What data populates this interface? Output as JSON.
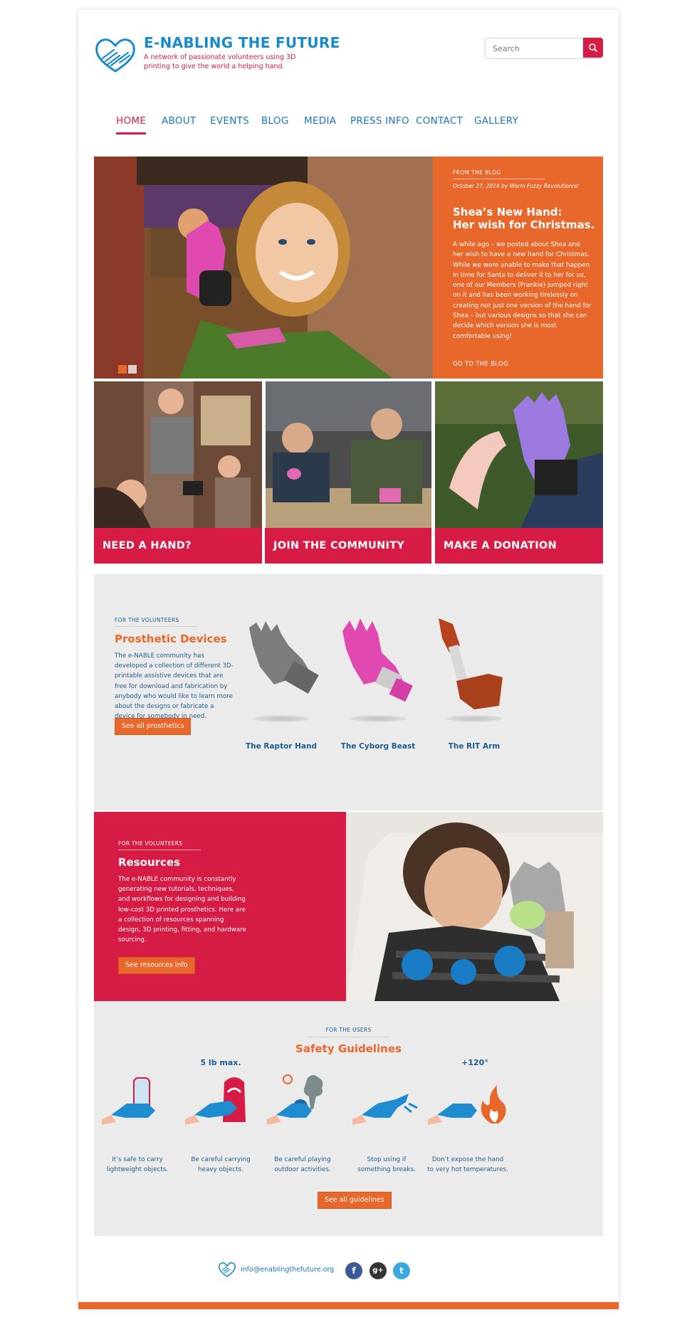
{
  "header": {
    "brand_title": "E-NABLING THE FUTURE",
    "tagline": "A network of passionate volunteers using 3D printing to give the world a helping hand.",
    "search_placeholder": "Search"
  },
  "nav": {
    "items": [
      {
        "label": "HOME",
        "active": true
      },
      {
        "label": "ABOUT"
      },
      {
        "label": "EVENTS"
      },
      {
        "label": "BLOG"
      },
      {
        "label": "MEDIA"
      },
      {
        "label": "PRESS INFO"
      },
      {
        "label": "CONTACT"
      },
      {
        "label": "GALLERY"
      }
    ]
  },
  "hero": {
    "kicker": "FROM THE BLOG",
    "meta": "October 27, 2014 by Warm Fuzzy Revolutionist",
    "title_line1": "Shea’s New Hand:",
    "title_line2": "Her wish for Christmas.",
    "body": "A while ago – we posted about Shea and her wish to have a new hand for Christmas. While we were unable to make that happen in time for Santa to deliver it to her for us, one of our Members (Frankie) jumped right on it and has been working tirelessly on creating not just one version of the hand for Shea – but various designs so that she can decide which version she is most comfortable using!",
    "link": "GO TO THE BLOG"
  },
  "cards": [
    {
      "label": "NEED A HAND?"
    },
    {
      "label": "JOIN THE COMMUNITY"
    },
    {
      "label": "MAKE A DONATION"
    }
  ],
  "prosthetics": {
    "kicker": "FOR THE VOLUNTEERS",
    "title": "Prosthetic Devices",
    "body": "The e-NABLE community has developed a collection of different 3D-printable assistive devices that are free for download and fabrication by anybody who would like to learn more about the designs or fabricate a device for somebody in need.",
    "button": "See all prosthetics",
    "items": [
      {
        "name": "The Raptor Hand"
      },
      {
        "name": "The Cyborg Beast"
      },
      {
        "name": "The RIT Arm"
      }
    ]
  },
  "resources": {
    "kicker": "FOR THE VOLUNTEERS",
    "title": "Resources",
    "body": "The e-NABLE community is constantly generating new tutorials, techniques, and workflows for designing and building low-cost 3D printed prosthetics. Here are a collection of resources spanning design, 3D printing, fitting, and hardware sourcing.",
    "button": "See resources info"
  },
  "safety": {
    "kicker": "FOR THE USERS",
    "title": "Safety Guidelines",
    "items": [
      {
        "caption_l1": "It’s safe to carry",
        "caption_l2": "lightweight objects."
      },
      {
        "caption_l1": "Be careful carrying",
        "caption_l2": "heavy objects.",
        "badge": "5 lb max."
      },
      {
        "caption_l1": "Be careful playing",
        "caption_l2": "outdoor activities."
      },
      {
        "caption_l1": "Stop using if",
        "caption_l2": "something breaks."
      },
      {
        "caption_l1": "Don’t expose the hand",
        "caption_l2": "to very hot temperatures.",
        "badge": "+120°"
      }
    ],
    "button": "See all guidelines"
  },
  "footer": {
    "email": "info@enablingthefuture.org",
    "social": [
      "f",
      "g+",
      "t"
    ]
  },
  "colors": {
    "brand_blue": "#1a8ac9",
    "red": "#d61c44",
    "orange": "#e8672a",
    "dark_blue": "#1e5d8e"
  }
}
